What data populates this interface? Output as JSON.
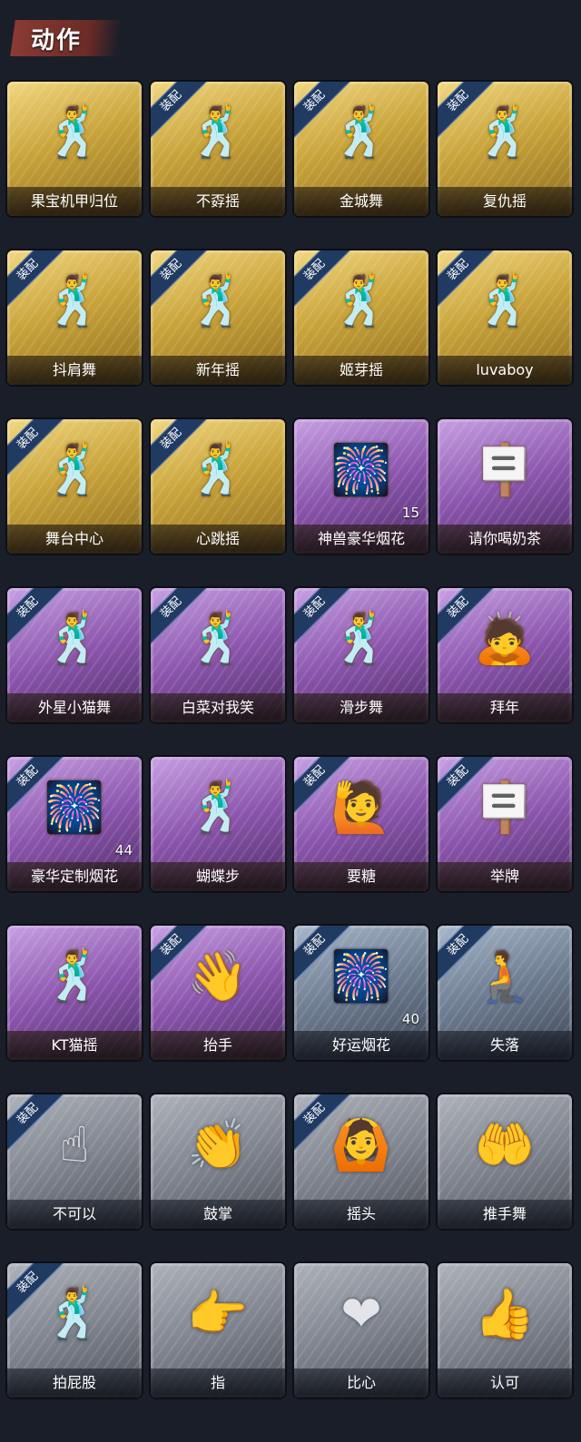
{
  "section_title": "动作",
  "equip_badge": "装配",
  "items": [
    {
      "name": "果宝机甲归位",
      "tier": "gold",
      "equipped": false,
      "icon": "dance-pose-icon",
      "count": ""
    },
    {
      "name": "不孬摇",
      "tier": "gold",
      "equipped": true,
      "icon": "dance-pose-icon",
      "count": ""
    },
    {
      "name": "金城舞",
      "tier": "gold",
      "equipped": true,
      "icon": "dance-pose-icon",
      "count": ""
    },
    {
      "name": "复仇摇",
      "tier": "gold",
      "equipped": true,
      "icon": "dance-pose-icon",
      "count": ""
    },
    {
      "name": "抖肩舞",
      "tier": "gold",
      "equipped": true,
      "icon": "dance-pose-icon",
      "count": ""
    },
    {
      "name": "新年摇",
      "tier": "gold",
      "equipped": true,
      "icon": "dance-pose-icon",
      "count": ""
    },
    {
      "name": "姬芽摇",
      "tier": "gold",
      "equipped": true,
      "icon": "dance-pose-icon",
      "count": ""
    },
    {
      "name": "luvaboy",
      "tier": "gold",
      "equipped": true,
      "icon": "dance-pose-icon",
      "count": ""
    },
    {
      "name": "舞台中心",
      "tier": "gold",
      "equipped": true,
      "icon": "dance-pose-icon",
      "count": ""
    },
    {
      "name": "心跳摇",
      "tier": "gold",
      "equipped": true,
      "icon": "dance-pose-icon",
      "count": ""
    },
    {
      "name": "神兽豪华烟花",
      "tier": "purple",
      "equipped": false,
      "icon": "fireworks-icon",
      "count": "15"
    },
    {
      "name": "请你喝奶茶",
      "tier": "purple",
      "equipped": false,
      "icon": "sign-holding-icon",
      "count": ""
    },
    {
      "name": "外星小猫舞",
      "tier": "purple",
      "equipped": true,
      "icon": "dance-pose-icon",
      "count": ""
    },
    {
      "name": "白菜对我笑",
      "tier": "purple",
      "equipped": true,
      "icon": "dance-pose-icon",
      "count": ""
    },
    {
      "name": "滑步舞",
      "tier": "purple",
      "equipped": true,
      "icon": "dance-pose-icon",
      "count": ""
    },
    {
      "name": "拜年",
      "tier": "purple",
      "equipped": true,
      "icon": "bow-pose-icon",
      "count": ""
    },
    {
      "name": "豪华定制烟花",
      "tier": "purple",
      "equipped": true,
      "icon": "fireworks-icon",
      "count": "44"
    },
    {
      "name": "蝴蝶步",
      "tier": "purple",
      "equipped": false,
      "icon": "dance-pose-icon",
      "count": ""
    },
    {
      "name": "要糖",
      "tier": "purple",
      "equipped": true,
      "icon": "reach-pose-icon",
      "count": ""
    },
    {
      "name": "举牌",
      "tier": "purple",
      "equipped": true,
      "icon": "sign-holding-icon",
      "count": ""
    },
    {
      "name": "KT猫摇",
      "tier": "purple",
      "equipped": false,
      "icon": "dance-pose-icon",
      "count": ""
    },
    {
      "name": "抬手",
      "tier": "purple",
      "equipped": true,
      "icon": "wave-pose-icon",
      "count": ""
    },
    {
      "name": "好运烟花",
      "tier": "blue",
      "equipped": true,
      "icon": "fireworks-icon",
      "count": "40"
    },
    {
      "name": "失落",
      "tier": "blue",
      "equipped": true,
      "icon": "crawl-pose-icon",
      "count": ""
    },
    {
      "name": "不可以",
      "tier": "gray",
      "equipped": true,
      "icon": "finger-wag-icon",
      "count": ""
    },
    {
      "name": "鼓掌",
      "tier": "gray",
      "equipped": false,
      "icon": "clap-icon",
      "count": ""
    },
    {
      "name": "摇头",
      "tier": "gray",
      "equipped": true,
      "icon": "head-shake-icon",
      "count": ""
    },
    {
      "name": "推手舞",
      "tier": "gray",
      "equipped": false,
      "icon": "push-pose-icon",
      "count": ""
    },
    {
      "name": "拍屁股",
      "tier": "gray",
      "equipped": true,
      "icon": "dance-pose-icon",
      "count": ""
    },
    {
      "name": "指",
      "tier": "gray",
      "equipped": false,
      "icon": "point-icon",
      "count": ""
    },
    {
      "name": "比心",
      "tier": "gray",
      "equipped": false,
      "icon": "heart-hands-icon",
      "count": ""
    },
    {
      "name": "认可",
      "tier": "gray",
      "equipped": false,
      "icon": "thumbs-up-icon",
      "count": ""
    }
  ]
}
